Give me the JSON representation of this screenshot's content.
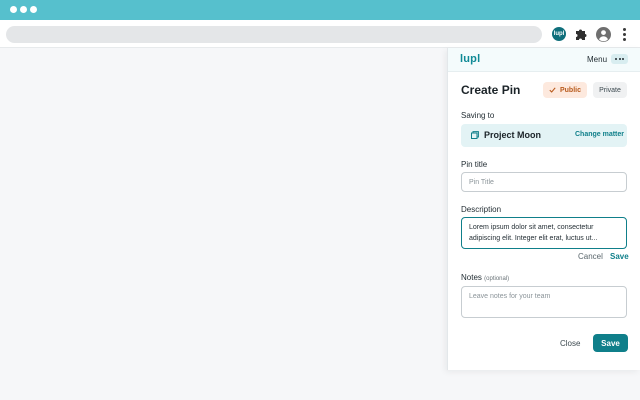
{
  "browser": {
    "extension_badge": "lupl",
    "icons": [
      "lupl-extension-icon",
      "puzzle-icon",
      "account-icon",
      "kebab-menu-icon"
    ]
  },
  "panel": {
    "logo": "lupl",
    "menu_label": "Menu",
    "title": "Create Pin",
    "visibility": {
      "public_label": "Public",
      "private_label": "Private",
      "selected": "Public"
    },
    "saving_to": {
      "label": "Saving to",
      "project": "Project Moon",
      "change_link": "Change matter"
    },
    "pin_title": {
      "label": "Pin title",
      "placeholder": "Pin Title",
      "value": ""
    },
    "description": {
      "label": "Description",
      "value_line1": "Lorem ipsum dolor sit amet, consectetur",
      "value_line2": "adipiscing elit. Integer elit erat, luctus ut...",
      "cancel_label": "Cancel",
      "save_label": "Save"
    },
    "notes": {
      "label": "Notes",
      "optional_label": "(optional)",
      "placeholder": "Leave notes for your team",
      "value": ""
    },
    "footer": {
      "close_label": "Close",
      "save_label": "Save"
    }
  },
  "colors": {
    "chrome": "#56c0cd",
    "accent": "#0f7f8a",
    "public_chip": "#fde9de"
  }
}
